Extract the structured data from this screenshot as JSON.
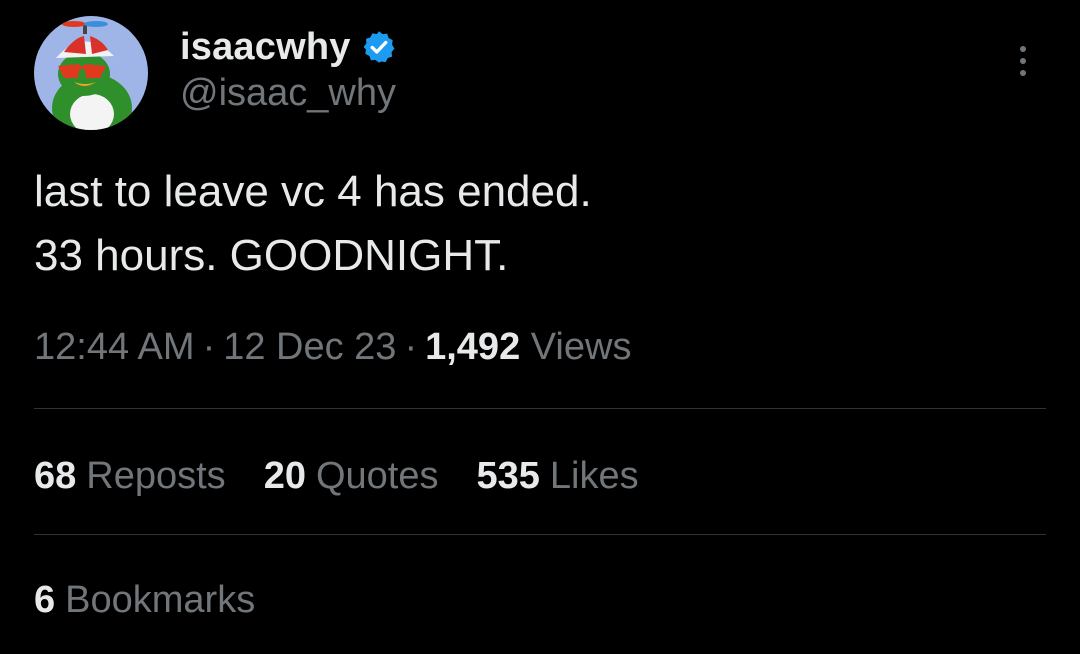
{
  "author": {
    "display_name": "isaacwhy",
    "handle": "@isaac_why",
    "verified": true
  },
  "tweet": {
    "lines": [
      "last to leave vc 4 has ended.",
      "33 hours. GOODNIGHT."
    ]
  },
  "meta": {
    "time": "12:44 AM",
    "date": "12 Dec 23",
    "separator": "·",
    "views_count": "1,492",
    "views_label": "Views"
  },
  "stats": {
    "reposts": {
      "count": "68",
      "label": "Reposts"
    },
    "quotes": {
      "count": "20",
      "label": "Quotes"
    },
    "likes": {
      "count": "535",
      "label": "Likes"
    },
    "bookmarks": {
      "count": "6",
      "label": "Bookmarks"
    }
  },
  "colors": {
    "background": "#000000",
    "primary_text": "#e7e9ea",
    "secondary_text": "#71767b",
    "divider": "#2f3336",
    "verified_badge": "#1d9bf0"
  },
  "icons": {
    "avatar": "green-bird-propeller-cap-avatar",
    "verified": "verified-badge-icon",
    "more": "more-options-icon"
  }
}
